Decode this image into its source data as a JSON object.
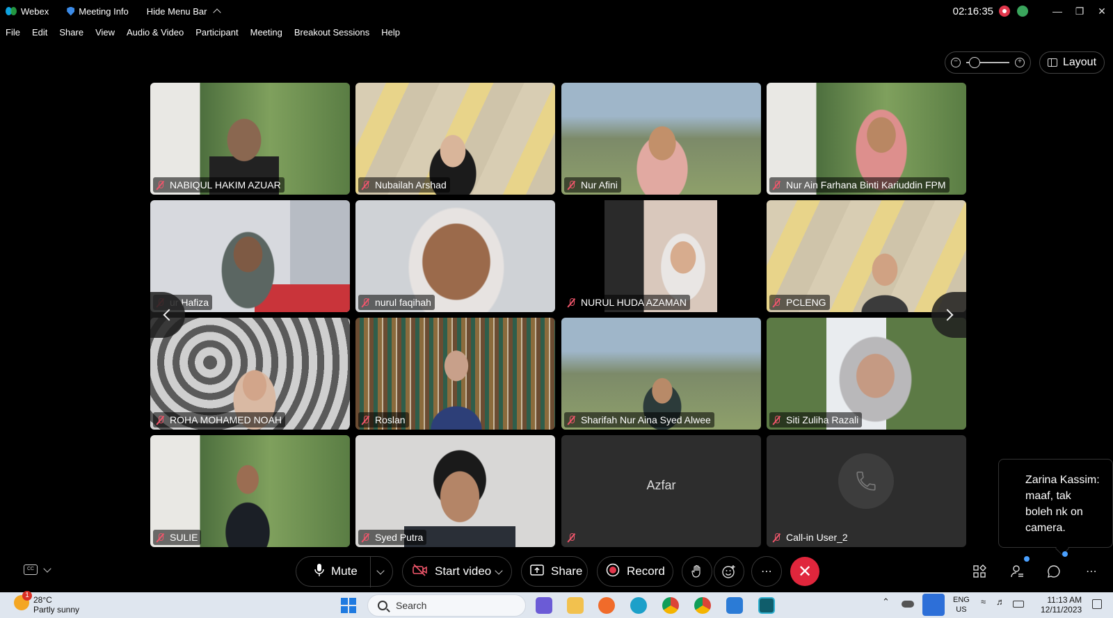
{
  "titlebar": {
    "app_name": "Webex",
    "meeting_info": "Meeting Info",
    "hide_menu_bar": "Hide Menu Bar",
    "clock": "02:16:35"
  },
  "menu": [
    "File",
    "Edit",
    "Share",
    "View",
    "Audio & Video",
    "Participant",
    "Meeting",
    "Breakout Sessions",
    "Help"
  ],
  "layout_label": "Layout",
  "participants": [
    "NABIQUL HAKIM AZUAR",
    "Nubailah Arshad",
    "Nur Afini",
    "Nur Ain Farhana Binti Kariuddin FPM",
    "ur Hafiza",
    "nurul faqihah",
    "NURUL HUDA AZAMAN",
    "PCLENG",
    "ROHA MOHAMED NOAH",
    "Roslan",
    "Sharifah Nur Aina Syed Alwee",
    "Siti Zuliha Razali",
    "SULIE",
    "Syed Putra",
    "",
    "Call-in User_2"
  ],
  "avatar_tile_name": "Azfar",
  "chat": {
    "sender": "Zarina Kassim:",
    "line1": "maaf, tak",
    "line2": "boleh nk on",
    "line3": "camera."
  },
  "controls": {
    "mute": "Mute",
    "start_video": "Start video",
    "share": "Share",
    "record": "Record"
  },
  "taskbar": {
    "temperature": "28°C",
    "weather": "Partly sunny",
    "weather_badge": "1",
    "search": "Search",
    "lang1": "ENG",
    "lang2": "US",
    "time": "11:13 AM",
    "date": "12/11/2023"
  },
  "colors": {
    "end_call": "#e0263c",
    "muted_mic": "#f0566b",
    "record_dot": "#e2374c",
    "taskbar": "#dfe6ef"
  }
}
